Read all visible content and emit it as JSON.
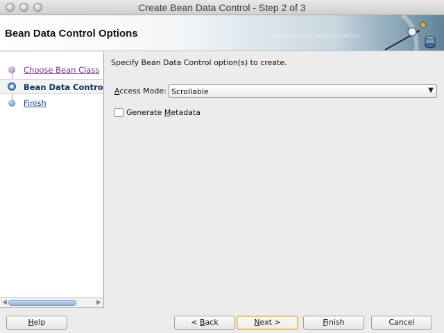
{
  "window": {
    "title": "Create Bean Data Control - Step 2 of 3",
    "controls": [
      "close-button",
      "minimize-button",
      "zoom-button"
    ]
  },
  "header": {
    "title": "Bean Data Control Options",
    "art_text": "010101010101010101010101010101"
  },
  "steps": [
    {
      "label": "Choose Bean Class",
      "state": "visited"
    },
    {
      "label": "Bean Data Control O",
      "state": "current"
    },
    {
      "label": "Finish",
      "state": "future"
    }
  ],
  "main": {
    "instruction": "Specify Bean Data Control option(s) to create.",
    "access_mode": {
      "label_mnemonic": "A",
      "label_rest": "ccess Mode:",
      "value": "Scrollable"
    },
    "generate_metadata": {
      "label_before": "Generate ",
      "label_mnemonic": "M",
      "label_after": "etadata",
      "checked": false
    }
  },
  "buttons": {
    "help": {
      "mnemonic": "H",
      "rest": "elp"
    },
    "back": {
      "prefix": "< ",
      "mnemonic": "B",
      "rest": "ack"
    },
    "next": {
      "mnemonic": "N",
      "rest": "ext >"
    },
    "finish": {
      "mnemonic": "F",
      "rest": "inish"
    },
    "cancel": {
      "label": "Cancel"
    }
  },
  "colors": {
    "accent": "#2a63a8",
    "visited": "#7a2f8e",
    "default_button_border": "#d9a44a"
  }
}
